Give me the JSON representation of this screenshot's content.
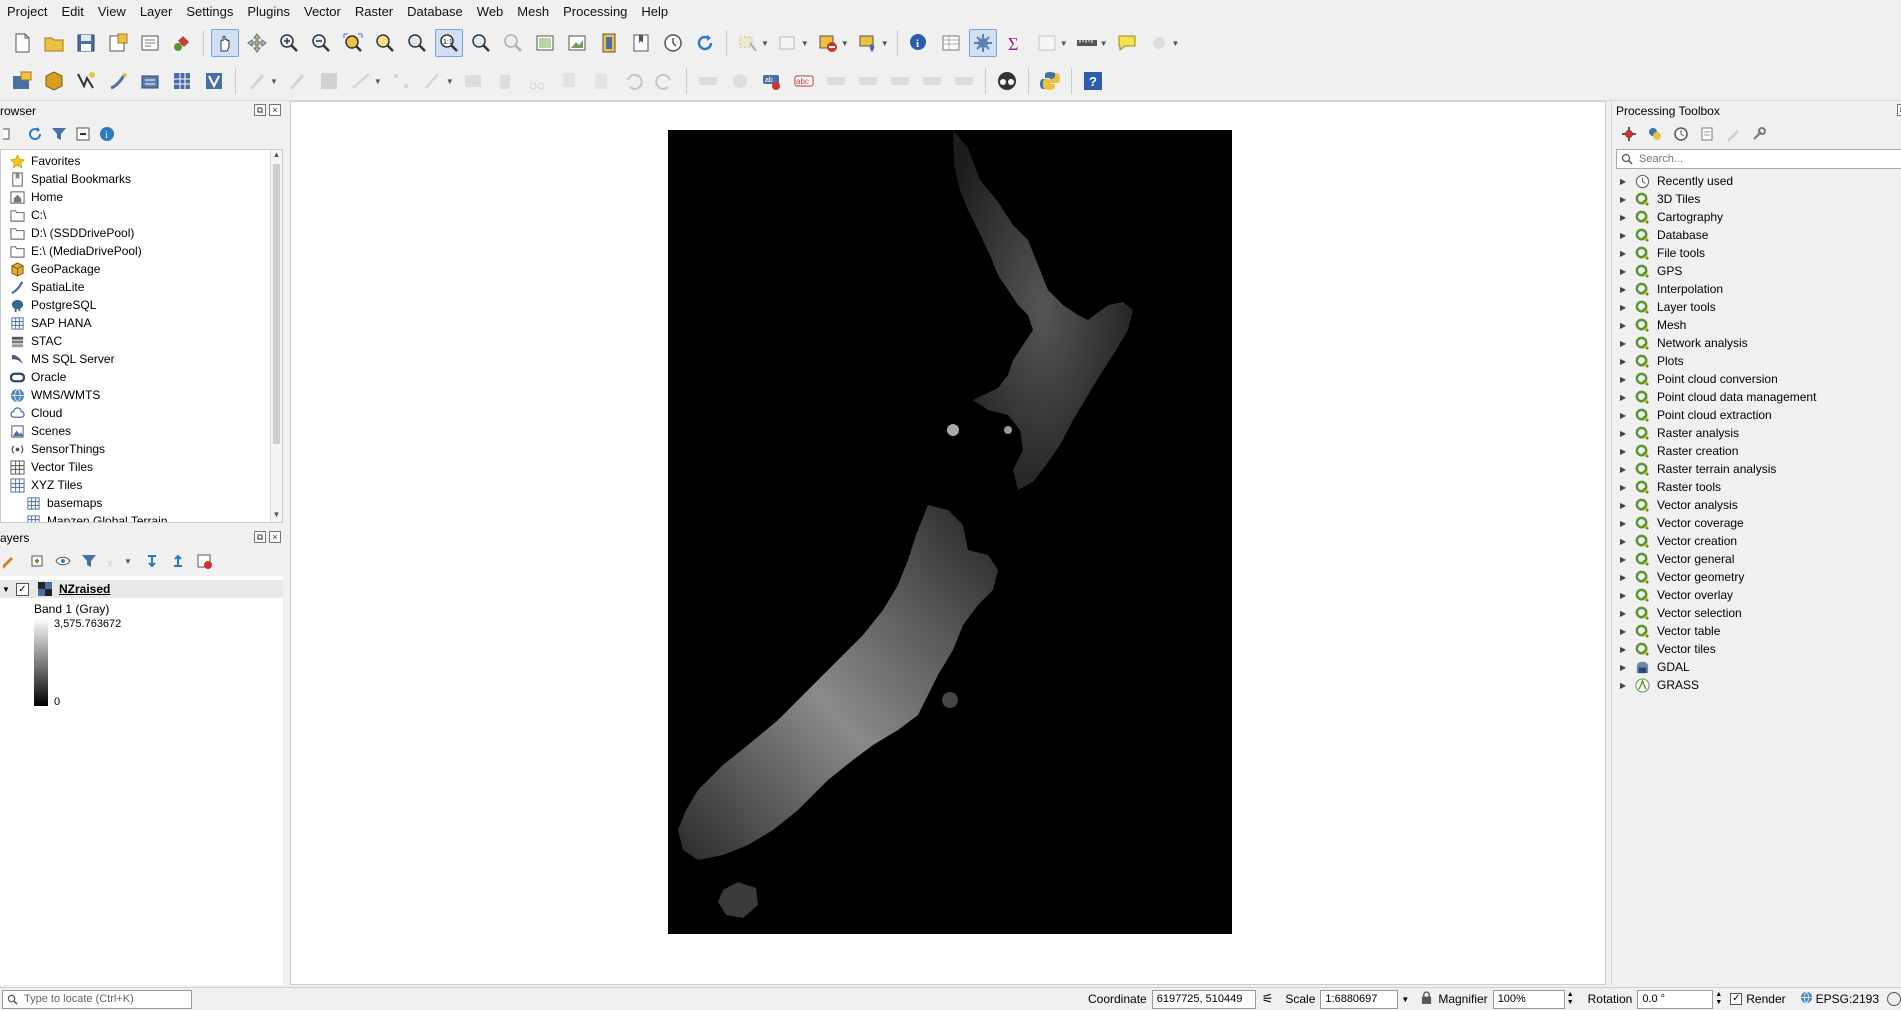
{
  "menu": [
    "Project",
    "Edit",
    "View",
    "Layer",
    "Settings",
    "Plugins",
    "Vector",
    "Raster",
    "Database",
    "Web",
    "Mesh",
    "Processing",
    "Help"
  ],
  "browser": {
    "title": "rowser",
    "items": [
      {
        "label": "Favorites",
        "icon": "star-icon"
      },
      {
        "label": "Spatial Bookmarks",
        "icon": "bookmark-icon"
      },
      {
        "label": "Home",
        "icon": "home-folder-icon"
      },
      {
        "label": "C:\\",
        "icon": "folder-icon"
      },
      {
        "label": "D:\\ (SSDDrivePool)",
        "icon": "folder-icon"
      },
      {
        "label": "E:\\ (MediaDrivePool)",
        "icon": "folder-icon"
      },
      {
        "label": "GeoPackage",
        "icon": "geopackage-icon"
      },
      {
        "label": "SpatiaLite",
        "icon": "spatialite-icon"
      },
      {
        "label": "PostgreSQL",
        "icon": "postgresql-icon"
      },
      {
        "label": "SAP HANA",
        "icon": "sap-hana-icon"
      },
      {
        "label": "STAC",
        "icon": "stac-icon"
      },
      {
        "label": "MS SQL Server",
        "icon": "mssql-icon"
      },
      {
        "label": "Oracle",
        "icon": "oracle-icon"
      },
      {
        "label": "WMS/WMTS",
        "icon": "globe-icon"
      },
      {
        "label": "Cloud",
        "icon": "cloud-icon"
      },
      {
        "label": "Scenes",
        "icon": "scenes-icon"
      },
      {
        "label": "SensorThings",
        "icon": "sensor-icon"
      },
      {
        "label": "Vector Tiles",
        "icon": "vector-tiles-icon"
      },
      {
        "label": "XYZ Tiles",
        "icon": "xyz-tiles-icon"
      },
      {
        "label": "basemaps",
        "icon": "grid-icon"
      },
      {
        "label": "Mapzen Global Terrain",
        "icon": "grid-icon"
      }
    ]
  },
  "layers": {
    "title": "ayers",
    "layer_name": "NZraised",
    "band_label": "Band 1 (Gray)",
    "max_value": "3,575.763672",
    "min_value": "0"
  },
  "toolbox": {
    "title": "Processing Toolbox",
    "search_placeholder": "Search...",
    "items": [
      {
        "label": "Recently used",
        "icon": "clock-icon"
      },
      {
        "label": "3D Tiles",
        "icon": "qgis-icon"
      },
      {
        "label": "Cartography",
        "icon": "qgis-icon"
      },
      {
        "label": "Database",
        "icon": "qgis-icon"
      },
      {
        "label": "File tools",
        "icon": "qgis-icon"
      },
      {
        "label": "GPS",
        "icon": "qgis-icon"
      },
      {
        "label": "Interpolation",
        "icon": "qgis-icon"
      },
      {
        "label": "Layer tools",
        "icon": "qgis-icon"
      },
      {
        "label": "Mesh",
        "icon": "qgis-icon"
      },
      {
        "label": "Network analysis",
        "icon": "qgis-icon"
      },
      {
        "label": "Plots",
        "icon": "qgis-icon"
      },
      {
        "label": "Point cloud conversion",
        "icon": "qgis-icon"
      },
      {
        "label": "Point cloud data management",
        "icon": "qgis-icon"
      },
      {
        "label": "Point cloud extraction",
        "icon": "qgis-icon"
      },
      {
        "label": "Raster analysis",
        "icon": "qgis-icon"
      },
      {
        "label": "Raster creation",
        "icon": "qgis-icon"
      },
      {
        "label": "Raster terrain analysis",
        "icon": "qgis-icon"
      },
      {
        "label": "Raster tools",
        "icon": "qgis-icon"
      },
      {
        "label": "Vector analysis",
        "icon": "qgis-icon"
      },
      {
        "label": "Vector coverage",
        "icon": "qgis-icon"
      },
      {
        "label": "Vector creation",
        "icon": "qgis-icon"
      },
      {
        "label": "Vector general",
        "icon": "qgis-icon"
      },
      {
        "label": "Vector geometry",
        "icon": "qgis-icon"
      },
      {
        "label": "Vector overlay",
        "icon": "qgis-icon"
      },
      {
        "label": "Vector selection",
        "icon": "qgis-icon"
      },
      {
        "label": "Vector table",
        "icon": "qgis-icon"
      },
      {
        "label": "Vector tiles",
        "icon": "qgis-icon"
      },
      {
        "label": "GDAL",
        "icon": "gdal-icon"
      },
      {
        "label": "GRASS",
        "icon": "grass-icon"
      }
    ]
  },
  "status": {
    "locate_placeholder": "Type to locate (Ctrl+K)",
    "coordinate_label": "Coordinate",
    "coordinate_value": "6197725, 510449",
    "scale_label": "Scale",
    "scale_value": "1:6880697",
    "magnifier_label": "Magnifier",
    "magnifier_value": "100%",
    "rotation_label": "Rotation",
    "rotation_value": "0.0 °",
    "render_label": "Render",
    "crs_label": "EPSG:2193"
  },
  "colors": {
    "qgis_green": "#589632",
    "qgis_yellow": "#f0b41e",
    "highlight": "#cfe0f5"
  }
}
